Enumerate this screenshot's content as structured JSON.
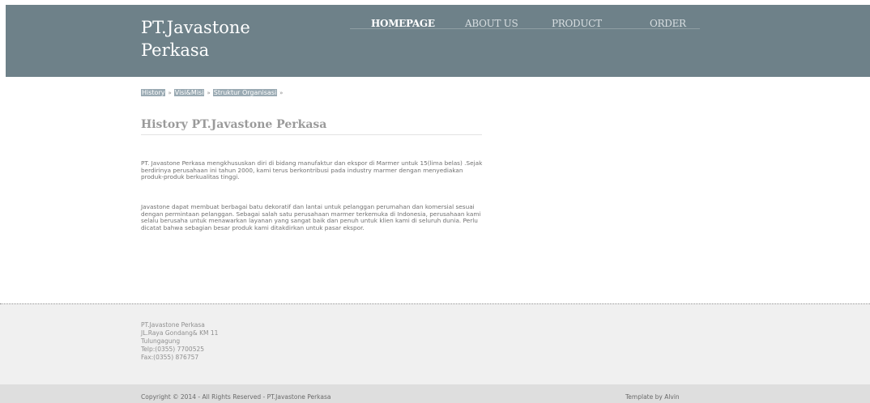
{
  "header": {
    "logo_line1": "PT.Javastone",
    "logo_line2": "Perkasa"
  },
  "nav": {
    "items": [
      {
        "label": "HOMEPAGE",
        "active": true
      },
      {
        "label": "ABOUT US",
        "active": false
      },
      {
        "label": "PRODUCT",
        "active": false
      },
      {
        "label": "ORDER",
        "active": false
      }
    ]
  },
  "breadcrumb": {
    "items": [
      "History",
      "Visi&Misi",
      "Struktur Organisasi"
    ],
    "separator": "»"
  },
  "main": {
    "title": "History PT.Javastone Perkasa",
    "paragraph1": "PT. Javastone Perkasa mengkhususkan diri di bidang manufaktur dan ekspor di Marmer untuk 15(lima belas) .Sejak berdirinya perusahaan ini tahun 2000, kami terus berkontribusi pada industry marmer dengan menyediakan produk-produk berkualitas tinggi.",
    "paragraph2": "Javastone dapat membuat berbagai batu dekoratif dan lantai untuk pelanggan perumahan dan komersial sesuai dengan permintaan pelanggan. Sebagai salah satu perusahaan marmer terkemuka di Indonesia, perusahaan kami selalu berusaha untuk menawarkan layanan yang sangat baik dan penuh untuk klien kami di seluruh dunia. Perlu dicatat bahwa sebagian besar produk kami ditakdirkan untuk pasar ekspor."
  },
  "footer": {
    "address": {
      "company": "PT.Javastone Perkasa",
      "street": "JL.Raya Gondang& KM 11",
      "city": "Tulungagung",
      "phone": "Telp:(0355) 7700525",
      "fax": "Fax:(0355) 876757"
    },
    "copyright": "Copyright © 2014 - All Rights Reserved - PT.Javastone Perkasa",
    "credit": "Template by Alvin"
  },
  "colors": {
    "header_bg": "#6e8189",
    "crumb_bg": "#9aaab3",
    "footer_bg": "#f0f0f0",
    "bottom_bar_bg": "#dedede"
  }
}
